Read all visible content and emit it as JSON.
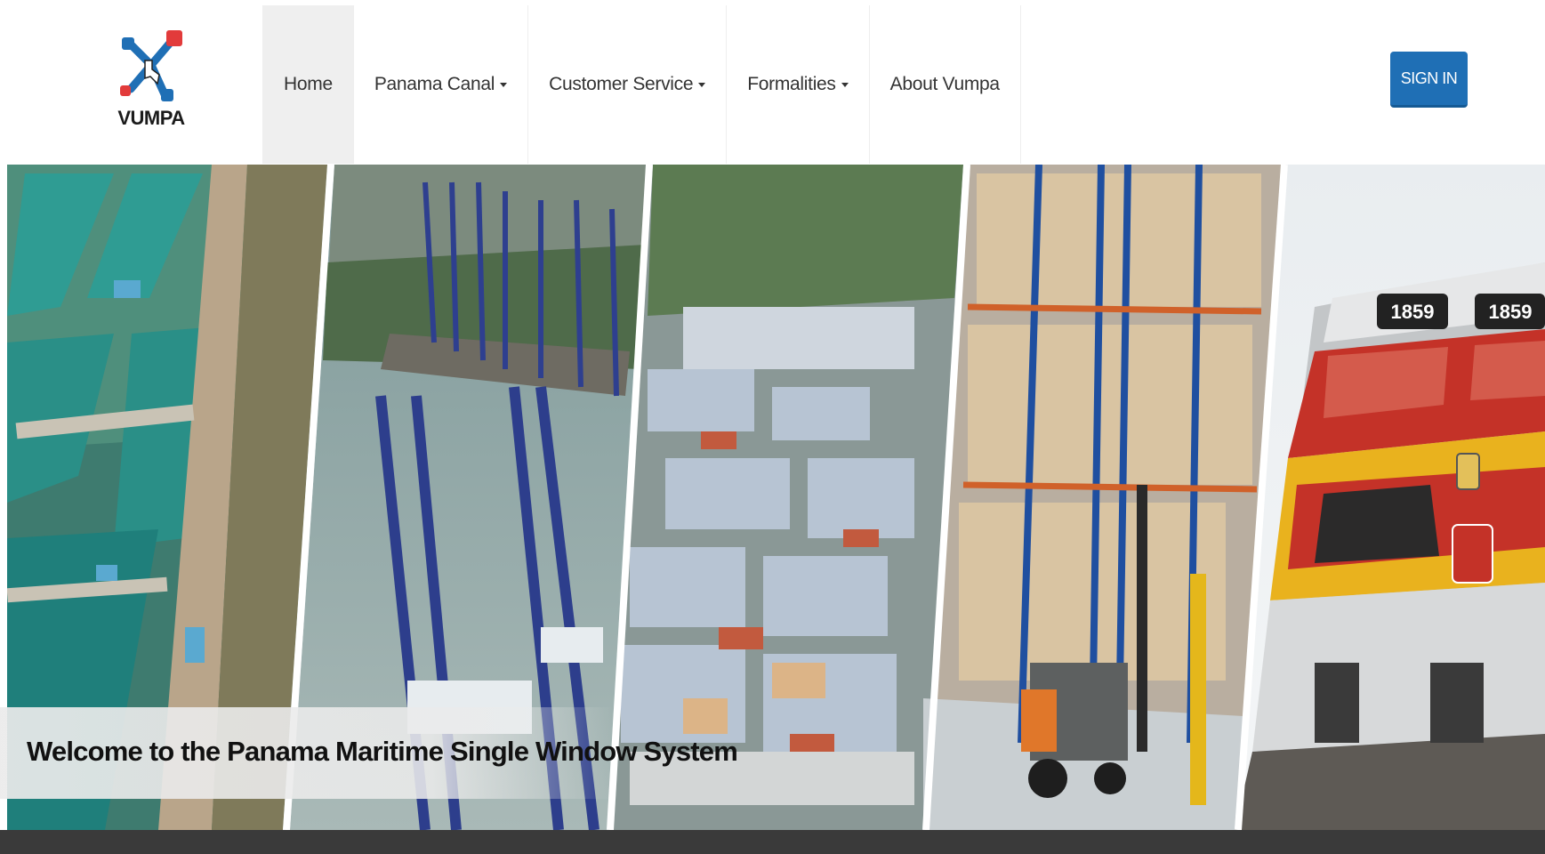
{
  "brand": {
    "logo_text": "VUMPA",
    "accent": "#1f6fb5"
  },
  "nav": {
    "items": [
      {
        "label": "Home",
        "active": true,
        "dropdown": false
      },
      {
        "label": "Panama Canal",
        "active": false,
        "dropdown": true
      },
      {
        "label": "Customer Service",
        "active": false,
        "dropdown": true
      },
      {
        "label": "Formalities",
        "active": false,
        "dropdown": true
      },
      {
        "label": "About Vumpa",
        "active": false,
        "dropdown": false
      }
    ]
  },
  "header": {
    "signin_label": "SIGN IN"
  },
  "hero": {
    "caption": "Welcome to the Panama Maritime Single Window System",
    "locomotive_number": "1859"
  },
  "colors": {
    "bottom_bar": "#3a3a3a"
  }
}
